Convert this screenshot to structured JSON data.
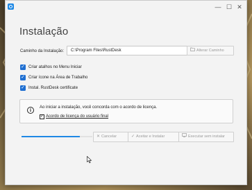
{
  "window": {
    "title": "",
    "heading": "Instalação",
    "controls": {
      "minimize": "—",
      "maximize": "☐",
      "close": "✕"
    }
  },
  "install_path": {
    "label": "Caminho da Instalação:",
    "value": "C:\\Program Files\\RustDesk",
    "change_button": "Alterar Caminho"
  },
  "options": [
    {
      "label": "Criar atalhos no Menu Iniciar",
      "checked": true
    },
    {
      "label": "Criar ícone na Área de Trabalho",
      "checked": true
    },
    {
      "label": "Instal. RustDesk certificate",
      "checked": true
    }
  ],
  "notice": {
    "text": "Ao iniciar a instalação, você concorda com o acordo de licença.",
    "license_link": "Acordo de licença do usuário final"
  },
  "progress": {
    "fraction": 0.82
  },
  "buttons": {
    "cancel": "Cancelar",
    "accept": "Aceitar e Instalar",
    "run_without": "Executar sem instalar"
  },
  "colors": {
    "accent": "#1e88e5",
    "checkbox": "#1f6fd1"
  },
  "icons": {
    "app": "rustdesk-icon",
    "info": "info-icon",
    "folder": "folder-icon",
    "cancel": "close-icon",
    "accept": "check-icon",
    "run": "computer-icon"
  }
}
